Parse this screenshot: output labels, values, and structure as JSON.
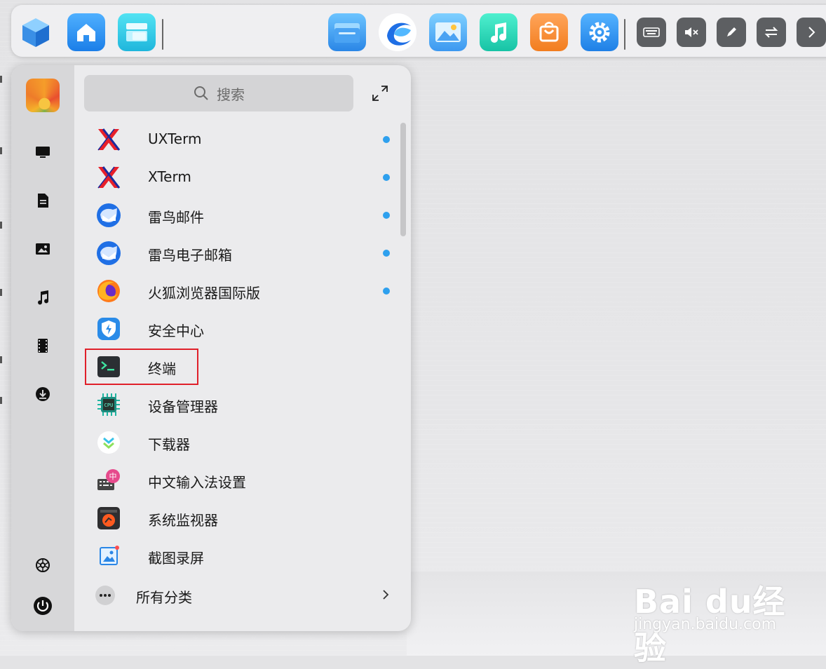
{
  "search": {
    "placeholder": "搜索"
  },
  "apps": [
    {
      "label": "UXTerm",
      "icon": "uxterm-icon",
      "new": true
    },
    {
      "label": "XTerm",
      "icon": "xterm-icon",
      "new": true
    },
    {
      "label": "雷鸟邮件",
      "icon": "thunderbird-icon",
      "new": true
    },
    {
      "label": "雷鸟电子邮箱",
      "icon": "thunderbird-icon",
      "new": true
    },
    {
      "label": "火狐浏览器国际版",
      "icon": "firefox-icon",
      "new": true
    },
    {
      "label": "安全中心",
      "icon": "security-center-icon",
      "new": false
    },
    {
      "label": "终端",
      "icon": "terminal-icon",
      "new": false
    },
    {
      "label": "设备管理器",
      "icon": "device-manager-icon",
      "new": false
    },
    {
      "label": "下载器",
      "icon": "downloader-icon",
      "new": false
    },
    {
      "label": "中文输入法设置",
      "icon": "input-method-icon",
      "new": false
    },
    {
      "label": "系统监视器",
      "icon": "system-monitor-icon",
      "new": false
    },
    {
      "label": "截图录屏",
      "icon": "screenshot-icon",
      "new": false
    }
  ],
  "all_categories": {
    "label": "所有分类"
  },
  "watermark": {
    "main": "Bai du经验",
    "sub": "jingyan.baidu.com"
  },
  "colors": {
    "accent": "#2ea0ee",
    "highlight": "#e0202a"
  }
}
